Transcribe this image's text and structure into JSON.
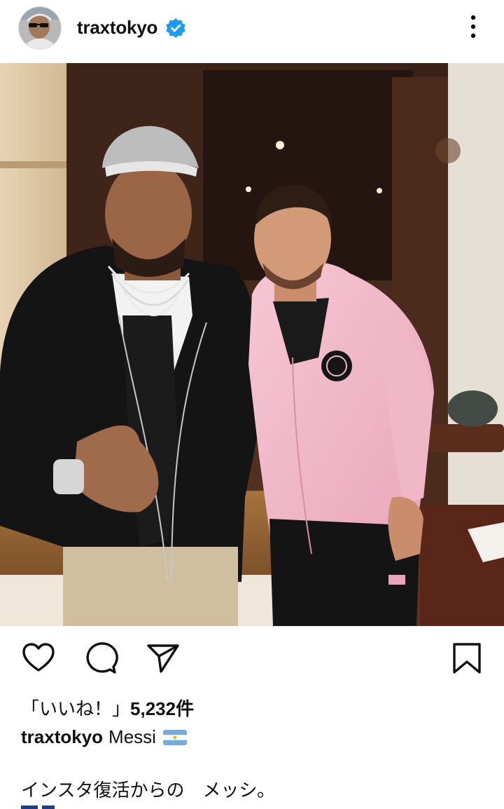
{
  "post": {
    "username": "traxtokyo",
    "verified_badge": "verified-icon",
    "menu_icon": "more-options-icon",
    "likes_prefix": "「いいね！」",
    "likes_count": "5,232件",
    "caption_user": "traxtokyo",
    "caption_first_line": "Messi",
    "caption_flag": "argentina-flag",
    "caption_body": "インスタ復活からの　メッシ。"
  },
  "actions": {
    "like_icon": "heart-icon",
    "comment_icon": "comment-icon",
    "share_icon": "send-icon",
    "save_icon": "bookmark-icon"
  },
  "colors": {
    "verified_blue": "#1d9bf0",
    "text": "#111111",
    "jacket_pink": "#f1b8c8"
  }
}
